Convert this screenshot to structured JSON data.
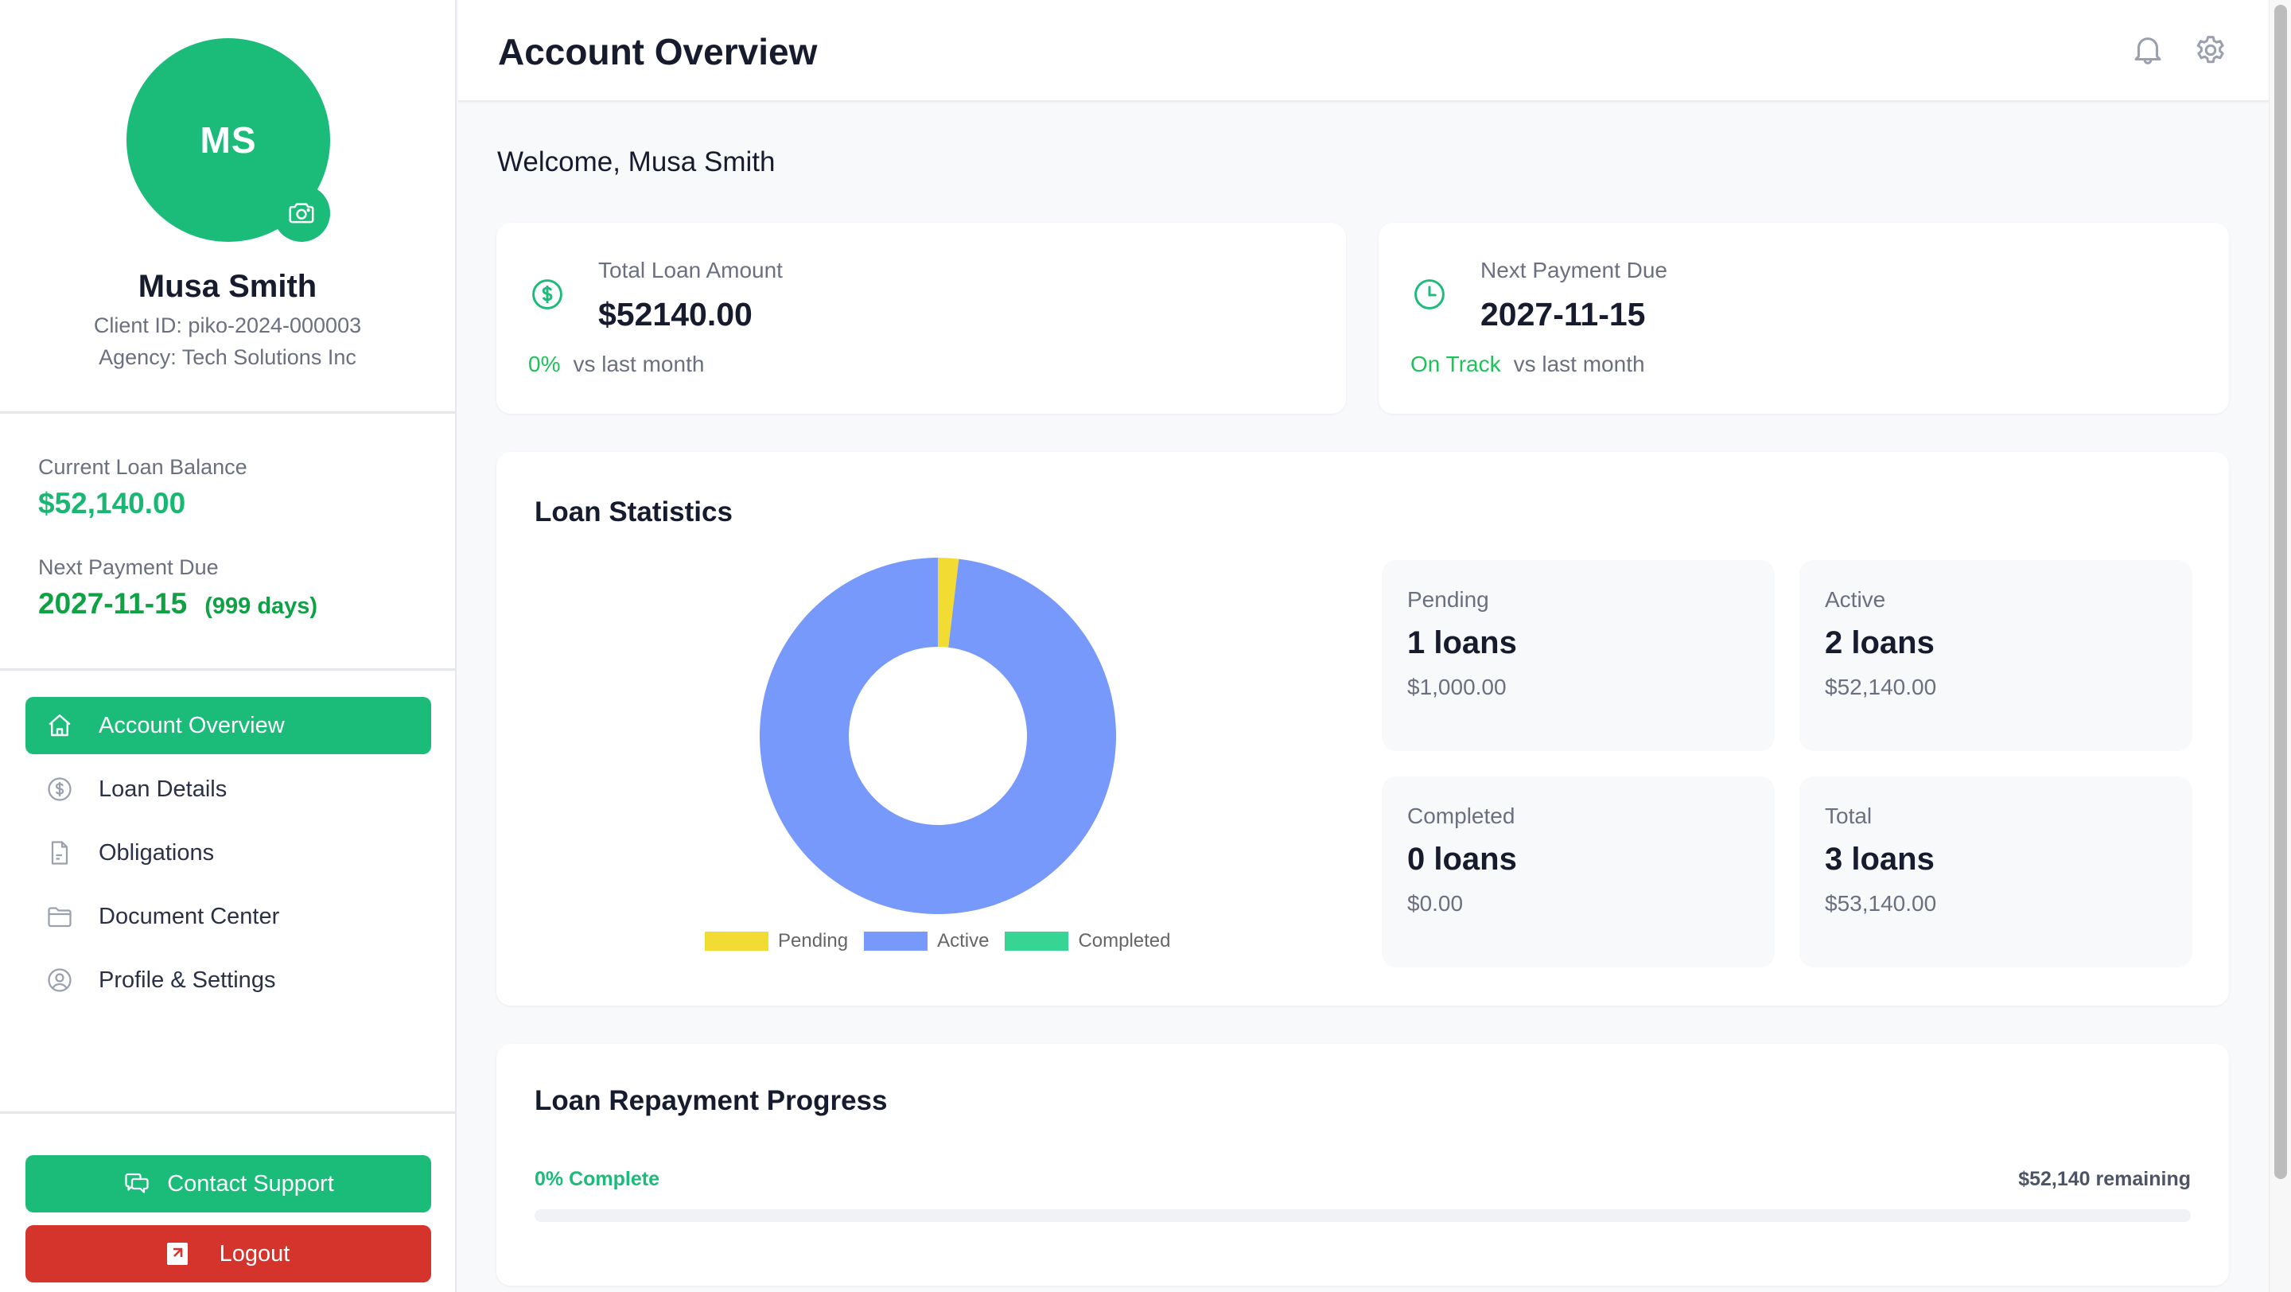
{
  "profile": {
    "initials": "MS",
    "name": "Musa Smith",
    "client_id": "Client ID: piko-2024-000003",
    "agency": "Agency: Tech Solutions Inc"
  },
  "balance": {
    "current_label": "Current Loan Balance",
    "current_value": "$52,140.00",
    "next_label": "Next Payment Due",
    "next_date": "2027-11-15",
    "next_days": "(999 days)"
  },
  "nav": {
    "items": [
      {
        "label": "Account Overview",
        "icon": "home-icon",
        "active": true
      },
      {
        "label": "Loan Details",
        "icon": "dollar-circle-icon",
        "active": false
      },
      {
        "label": "Obligations",
        "icon": "document-icon",
        "active": false
      },
      {
        "label": "Document Center",
        "icon": "folder-icon",
        "active": false
      },
      {
        "label": "Profile & Settings",
        "icon": "user-circle-icon",
        "active": false
      }
    ]
  },
  "actions": {
    "support_label": "Contact Support",
    "logout_label": "Logout"
  },
  "header": {
    "title": "Account Overview",
    "icons": [
      "bell-icon",
      "gear-icon"
    ]
  },
  "welcome": "Welcome, Musa Smith",
  "summary": [
    {
      "label": "Total Loan Amount",
      "value": "$52140.00",
      "highlight": "0%",
      "foot": "vs last month",
      "icon": "dollar-circle-icon"
    },
    {
      "label": "Next Payment Due",
      "value": "2027-11-15",
      "highlight": "On Track",
      "foot": "vs last month",
      "icon": "clock-icon"
    }
  ],
  "stats": {
    "title": "Loan Statistics",
    "boxes": [
      {
        "label": "Pending",
        "count": "1 loans",
        "amount": "$1,000.00"
      },
      {
        "label": "Active",
        "count": "2 loans",
        "amount": "$52,140.00"
      },
      {
        "label": "Completed",
        "count": "0 loans",
        "amount": "$0.00"
      },
      {
        "label": "Total",
        "count": "3 loans",
        "amount": "$53,140.00"
      }
    ]
  },
  "chart_data": {
    "type": "pie",
    "variant": "doughnut",
    "title": "",
    "categories": [
      "Pending",
      "Active",
      "Completed"
    ],
    "values": [
      1000,
      52140,
      0
    ],
    "colors": [
      "#f2db33",
      "#7799fc",
      "#38d494"
    ],
    "legend_position": "bottom"
  },
  "progress": {
    "title": "Loan Repayment Progress",
    "percent_label": "0% Complete",
    "remaining_label": "$52,140 remaining",
    "percent": 0
  },
  "colors": {
    "brand": "#1bbb7a",
    "danger": "#d5342d",
    "positive": "#1ec25b"
  }
}
